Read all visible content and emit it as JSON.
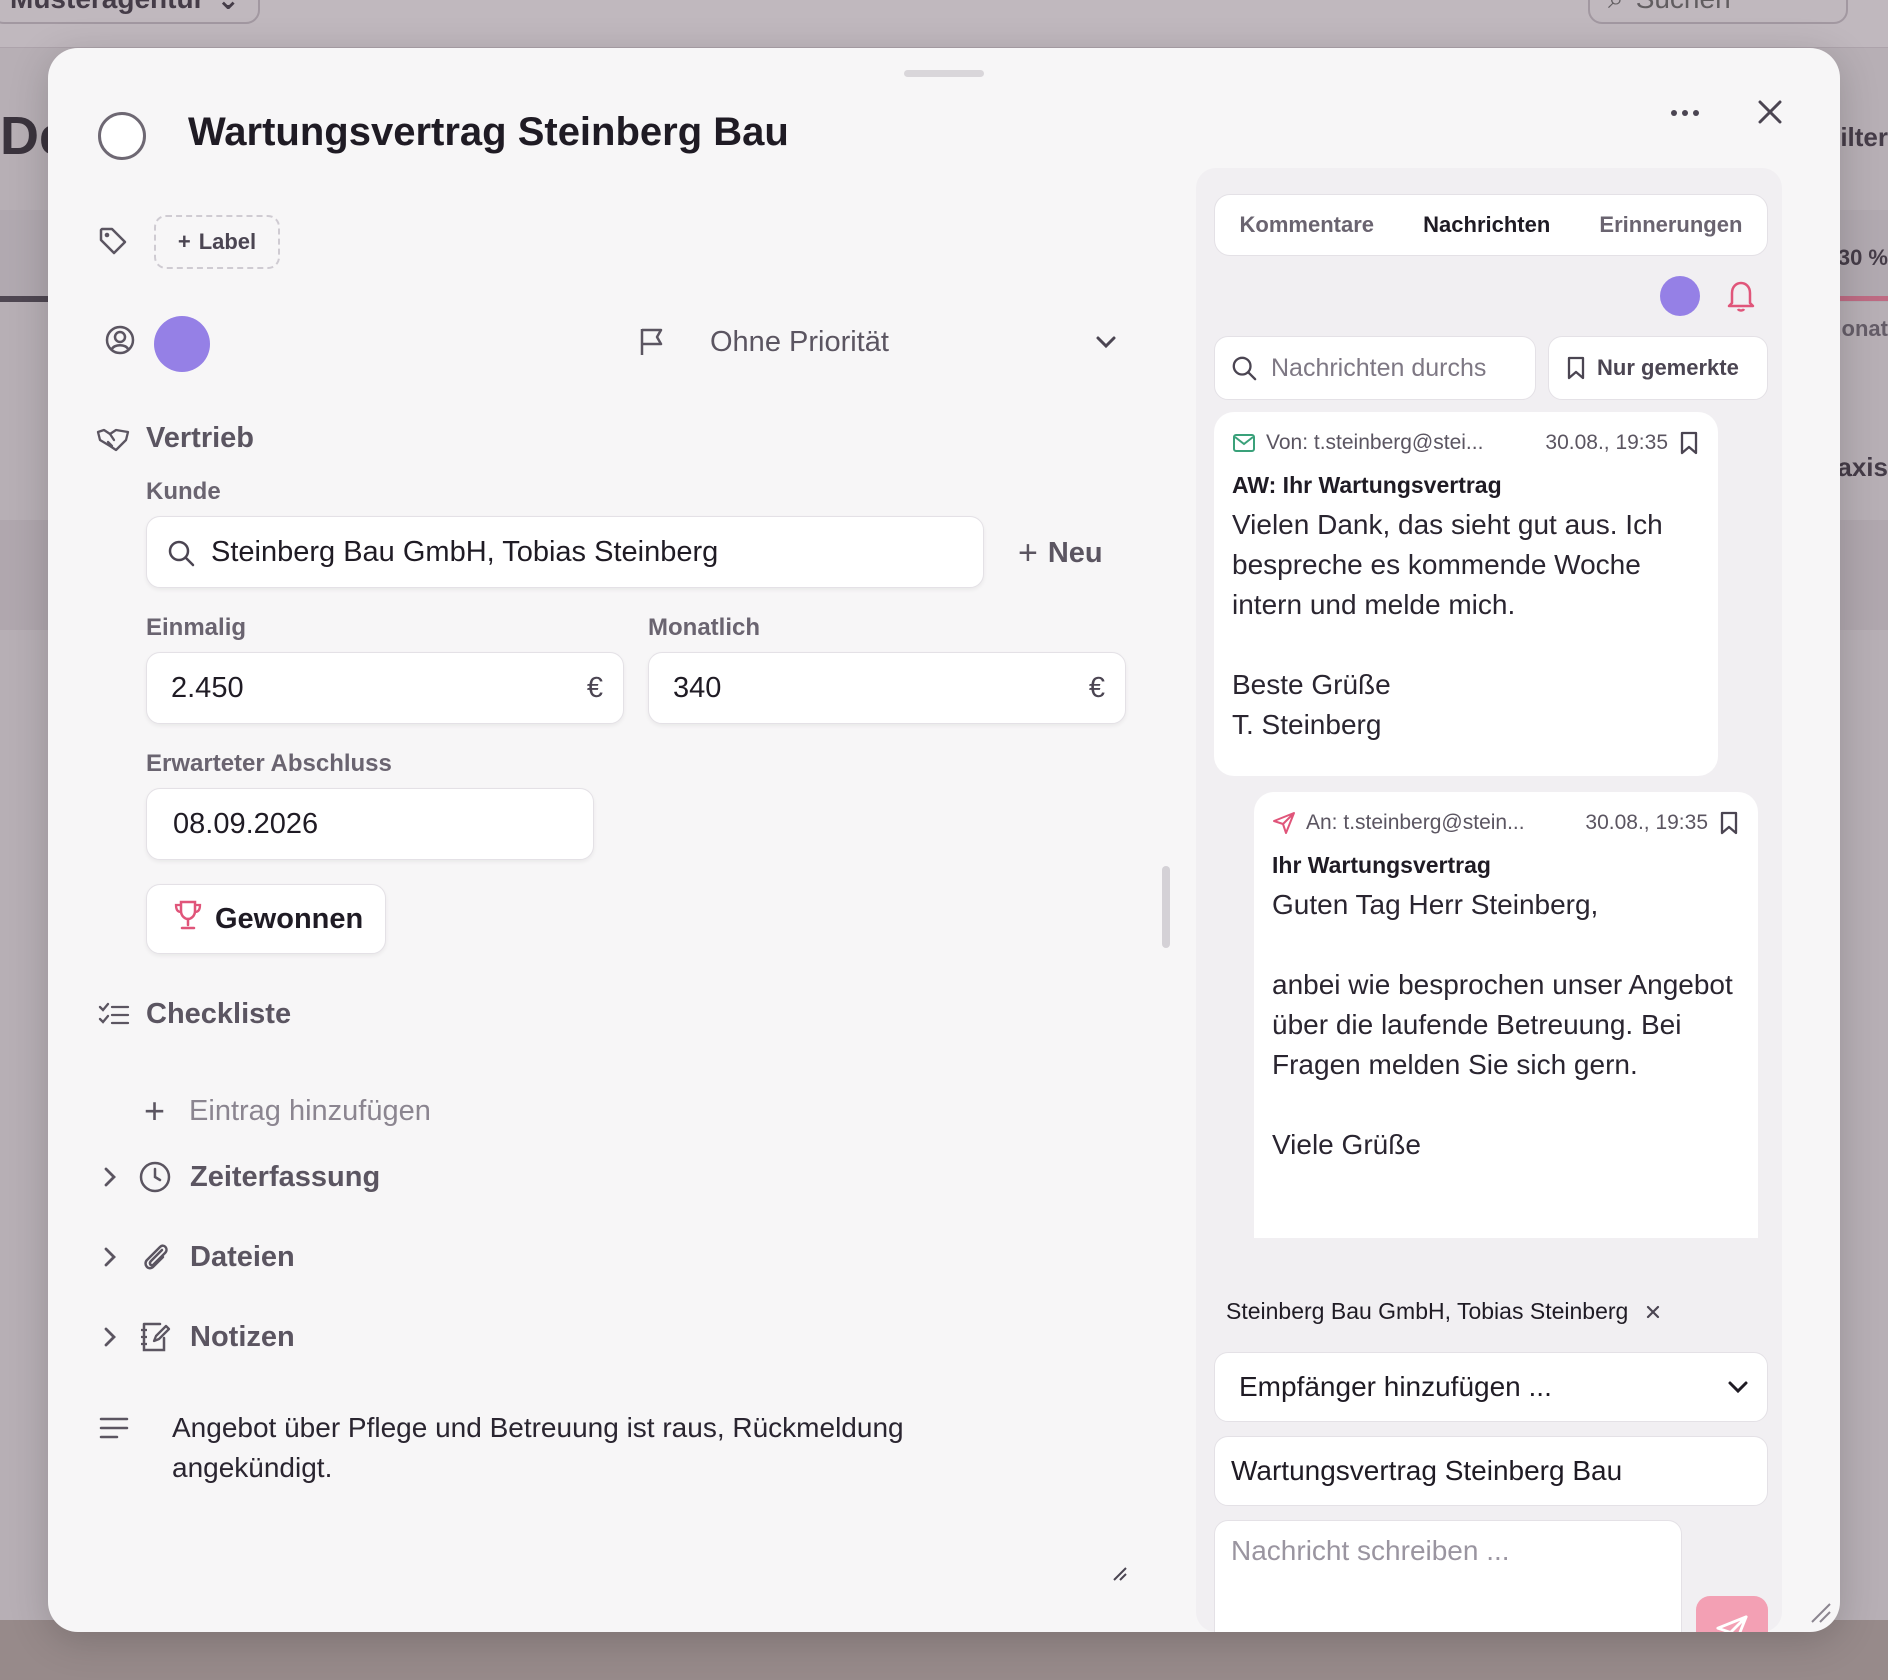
{
  "background": {
    "workspace": "Musteragentur",
    "search": "Suchen",
    "title": "De",
    "right_labels": [
      "ilter",
      "30 %",
      "lonat",
      "axis"
    ]
  },
  "task": {
    "title": "Wartungsvertrag Steinberg Bau",
    "label_button": "Label",
    "priority": "Ohne Priorität"
  },
  "sales": {
    "section": "Vertrieb",
    "customer_label": "Kunde",
    "customer_value": "Steinberg Bau GmbH, Tobias Steinberg",
    "new_button": "Neu",
    "once_label": "Einmalig",
    "once_value": "2.450",
    "monthly_label": "Monatlich",
    "monthly_value": "340",
    "currency": "€",
    "close_label": "Erwarteter Abschluss",
    "close_value": "08.09.2026",
    "won_button": "Gewonnen"
  },
  "checklist": {
    "title": "Checkliste",
    "add_entry": "Eintrag hinzufügen"
  },
  "sections": {
    "time": "Zeiterfassung",
    "files": "Dateien",
    "notes": "Notizen"
  },
  "description": "Angebot über Pflege und Betreuung ist raus, Rückmeldung angekündigt.",
  "panel": {
    "tabs": [
      "Kommentare",
      "Nachrichten",
      "Erinnerungen"
    ],
    "active_tab": "Nachrichten",
    "search_placeholder": "Nachrichten durchs",
    "marked_button": "Nur gemerkte",
    "messages": [
      {
        "direction": "incoming",
        "from": "Von: t.steinberg@stei...",
        "time": "30.08., 19:35",
        "subject": "AW: Ihr Wartungsvertrag",
        "body": "Vielen Dank, das sieht gut aus. Ich bespreche es kommende Woche intern und melde mich.\n\nBeste Grüße\nT. Steinberg"
      },
      {
        "direction": "outgoing",
        "from": "An: t.steinberg@stein...",
        "time": "30.08., 19:35",
        "subject": "Ihr Wartungsvertrag",
        "body": "Guten Tag Herr Steinberg,\n\nanbei wie besprochen unser Angebot über die laufende Betreuung. Bei Fragen melden Sie sich gern.\n\nViele Grüße"
      }
    ],
    "recipient_chip": "Steinberg Bau GmbH, Tobias Steinberg",
    "add_recipient": "Empfänger hinzufügen ...",
    "subject_value": "Wartungsvertrag Steinberg Bau",
    "message_placeholder": "Nachricht schreiben ..."
  },
  "colors": {
    "avatar": "#9580e6",
    "accent_pink": "#f3a0b4",
    "bell": "#e0557a",
    "mail_green": "#3aa17a",
    "trophy": "#e0557a"
  }
}
